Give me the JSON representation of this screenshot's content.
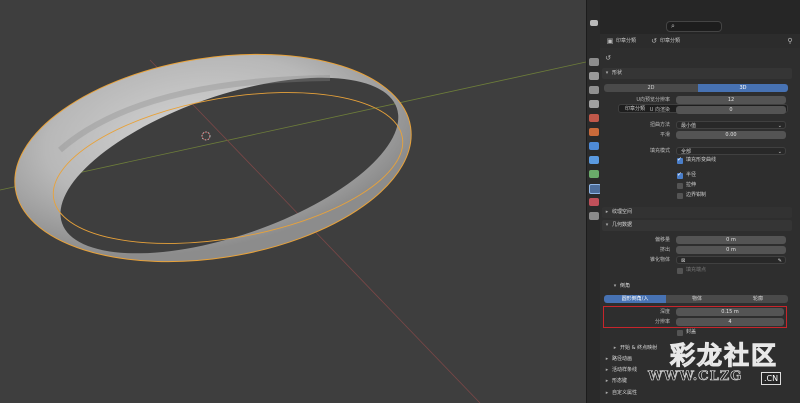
{
  "panel": {
    "tabs": [
      "印章分類",
      "印章分類"
    ],
    "object_name": "印章分類",
    "shape_header": "形状",
    "dim_2d": "2D",
    "dim_3d": "3D",
    "rows": [
      {
        "label": "U向预览分辨率",
        "value": "12"
      },
      {
        "label": "U 向渲染",
        "value": "0"
      },
      {
        "label": "扭曲方法",
        "value": "最小值"
      },
      {
        "label": "平滑",
        "value": "0.00"
      },
      {
        "label": "填充模式",
        "value": "全部"
      }
    ],
    "checks": [
      {
        "label": "填充形变曲线",
        "checked": true
      },
      {
        "label": "半径",
        "checked": true
      },
      {
        "label": "拉伸",
        "checked": false
      },
      {
        "label": "边界钳制",
        "checked": false
      }
    ],
    "sections": [
      "纹理空间",
      "几何数据"
    ],
    "geo_rows": [
      {
        "label": "偏移量",
        "value": "0 m"
      },
      {
        "label": "挤出",
        "value": "0 m"
      },
      {
        "label": "锥化物体",
        "value": ""
      }
    ],
    "fill_caps": "填充端点",
    "bevel_header": "倒角",
    "bevel_modes": [
      "圆形倒角/入",
      "物体",
      "轮廓"
    ],
    "depth_label": "深度",
    "depth_value": "0.15 m",
    "resolution_label": "分辨率",
    "resolution_value": "4",
    "fill_caps_2": "封盖",
    "more_sections": [
      "开始 & 终点映射",
      "路径动画",
      "活动样条线",
      "形态键",
      "自定义属性"
    ]
  },
  "watermark": {
    "title": "彩龙社区",
    "url": "WWW.CLZG",
    "badge": ".CN"
  }
}
